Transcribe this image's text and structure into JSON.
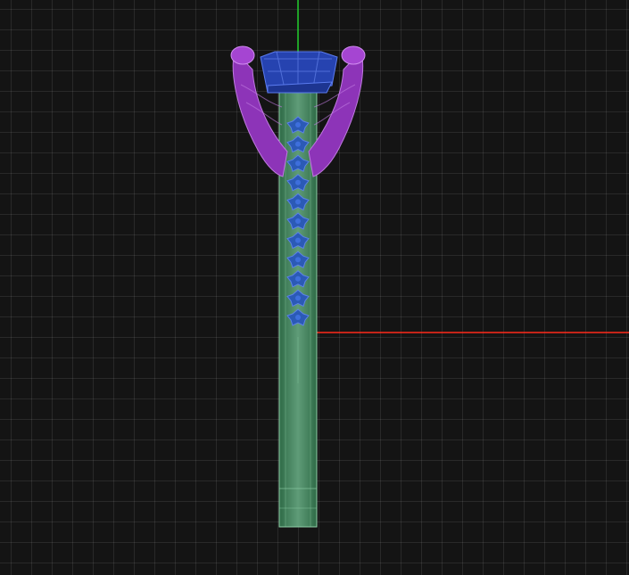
{
  "viewport": {
    "view": "front-orthographic",
    "background_color": "#141414",
    "grid_color": "#2a2a2a",
    "axis_x_color": "#ff2a1a",
    "axis_y_color": "#1fcc2a"
  },
  "model": {
    "parts": [
      {
        "id": "center-stone",
        "color": "#2a4db8"
      },
      {
        "id": "prong-head",
        "color": "#9b3bc6"
      },
      {
        "id": "band-shank",
        "color": "#3f8b5e"
      },
      {
        "id": "channel-stones",
        "color": "#2b5ab6",
        "count": 11
      }
    ]
  }
}
